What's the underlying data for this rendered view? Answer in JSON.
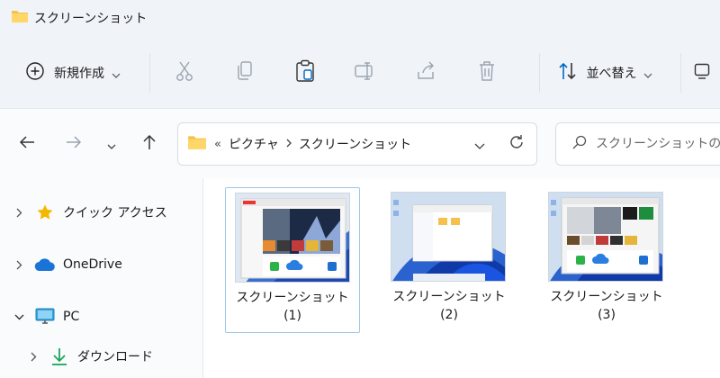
{
  "window": {
    "title": "スクリーンショット"
  },
  "toolbar": {
    "new_label": "新規作成",
    "sort_label": "並べ替え"
  },
  "address": {
    "overflow": "«",
    "crumbs": [
      "ピクチャ",
      "スクリーンショット"
    ]
  },
  "search": {
    "placeholder": "スクリーンショットの検索"
  },
  "sidebar": {
    "items": [
      {
        "label": "クイック アクセス"
      },
      {
        "label": "OneDrive"
      },
      {
        "label": "PC"
      },
      {
        "label": "ダウンロード"
      }
    ]
  },
  "files": [
    {
      "name": "スクリーンショット",
      "index": "(1)"
    },
    {
      "name": "スクリーンショット",
      "index": "(2)"
    },
    {
      "name": "スクリーンショット",
      "index": "(3)"
    }
  ],
  "colors": {
    "accent": "#0067c0",
    "folder": "#f4c24c",
    "selection": "#9ac8ea"
  }
}
